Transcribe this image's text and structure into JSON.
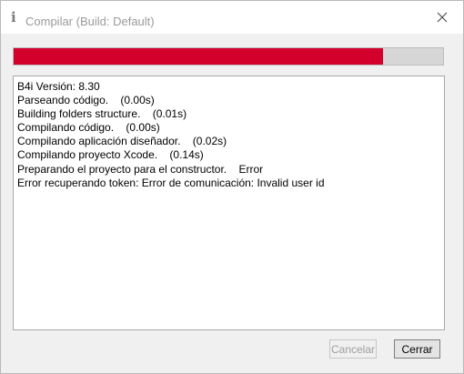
{
  "window": {
    "title_icon": "i",
    "title": "Compilar (Build: Default)",
    "close_icon": "close-icon"
  },
  "progress": {
    "fraction": 0.86,
    "fill_color": "#d2002a",
    "track_color": "#d6d6d6"
  },
  "log": {
    "lines": [
      "B4i Versión: 8.30",
      "Parseando código.    (0.00s)",
      "Building folders structure.    (0.01s)",
      "Compilando código.    (0.00s)",
      "Compilando aplicación diseñador.    (0.02s)",
      "Compilando proyecto Xcode.    (0.14s)",
      "Preparando el proyecto para el constructor.    Error",
      "Error recuperando token: Error de comunicación: Invalid user id"
    ]
  },
  "buttons": {
    "cancel_label": "Cancelar",
    "close_label": "Cerrar"
  }
}
